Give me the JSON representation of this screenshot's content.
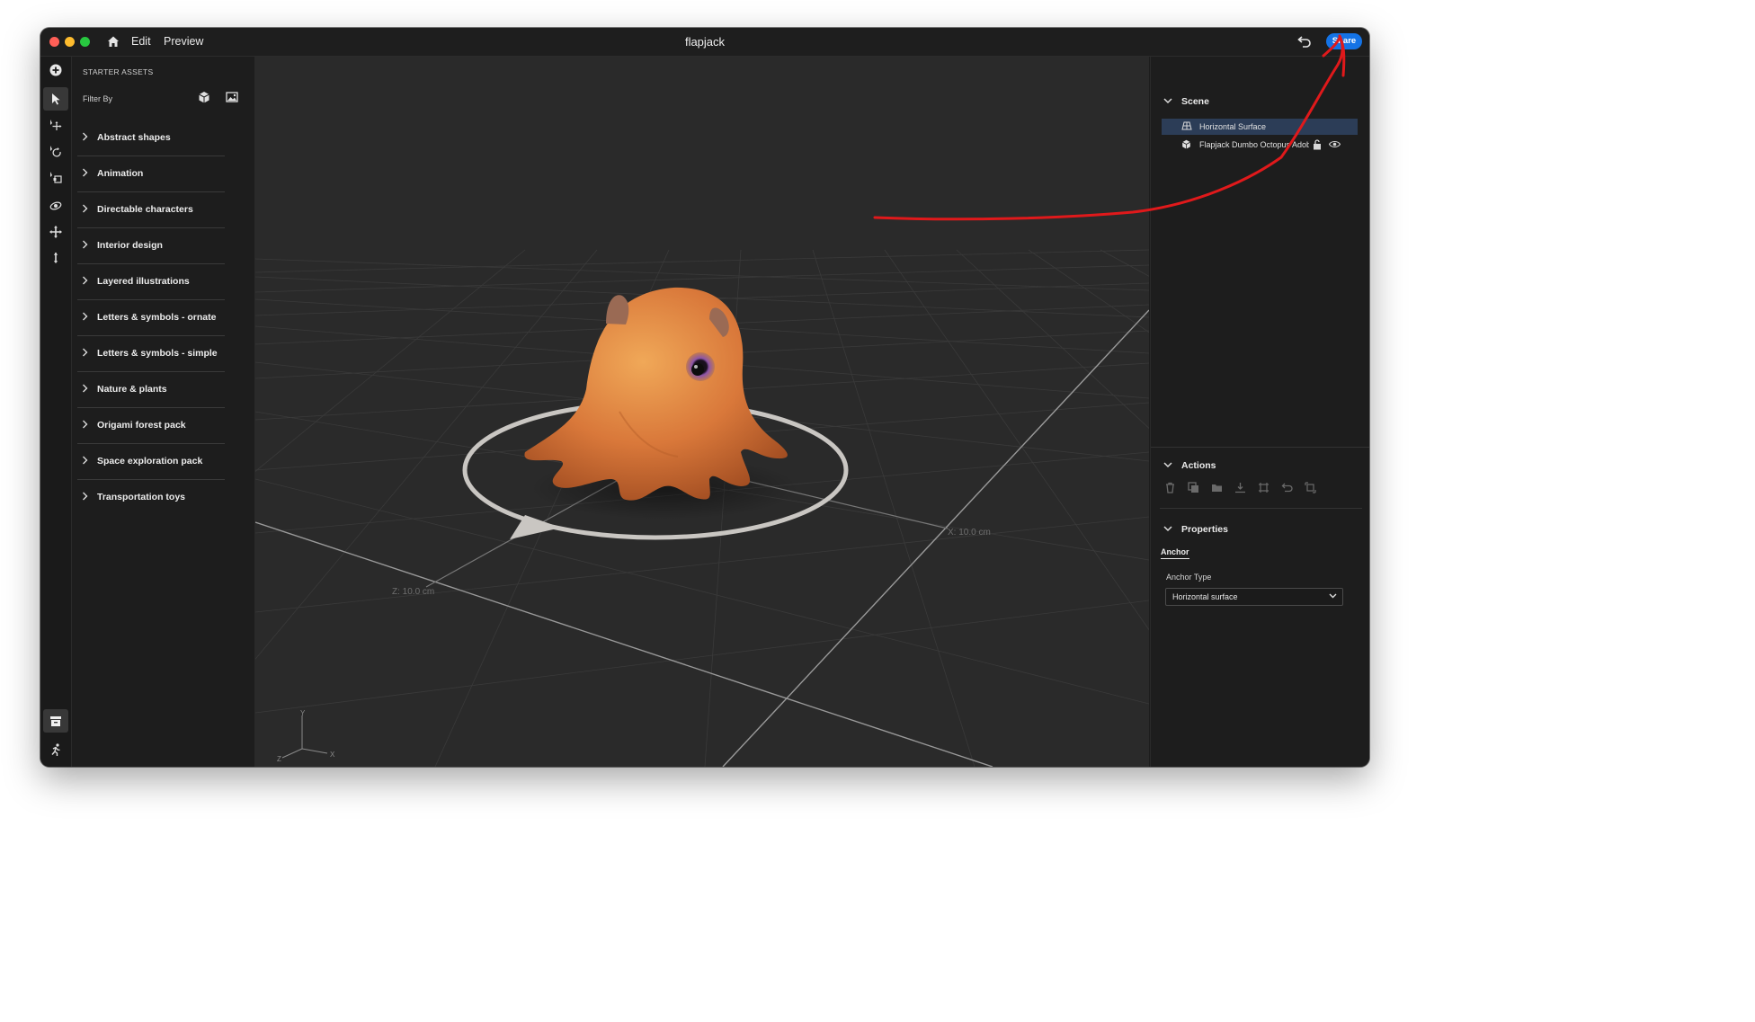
{
  "titlebar": {
    "menu": [
      "Edit",
      "Preview"
    ],
    "title": "flapjack",
    "share_label": "Share"
  },
  "assets": {
    "title": "STARTER ASSETS",
    "filter_label": "Filter By",
    "categories": [
      "Abstract shapes",
      "Animation",
      "Directable characters",
      "Interior design",
      "Layered illustrations",
      "Letters & symbols - ornate",
      "Letters & symbols - simple",
      "Nature & plants",
      "Origami forest pack",
      "Space exploration pack",
      "Transportation toys"
    ]
  },
  "viewport": {
    "x_axis_label": "X: 10.0 cm",
    "z_axis_label": "Z: 10.0 cm",
    "gizmo": {
      "y": "Y",
      "x": "X",
      "z": "Z"
    }
  },
  "scene": {
    "heading": "Scene",
    "items": [
      {
        "label": "Horizontal Surface",
        "selected": true
      },
      {
        "label": "Flapjack Dumbo Octopus Adobe",
        "selected": false
      }
    ]
  },
  "actions": {
    "heading": "Actions"
  },
  "properties": {
    "heading": "Properties",
    "tab": "Anchor",
    "anchor_type_label": "Anchor Type",
    "anchor_type_value": "Horizontal surface"
  },
  "colors": {
    "accent": "#1473e6",
    "annotation": "#e0191b",
    "selected_row": "#2c3d57",
    "octopus": "#e08a3c"
  }
}
